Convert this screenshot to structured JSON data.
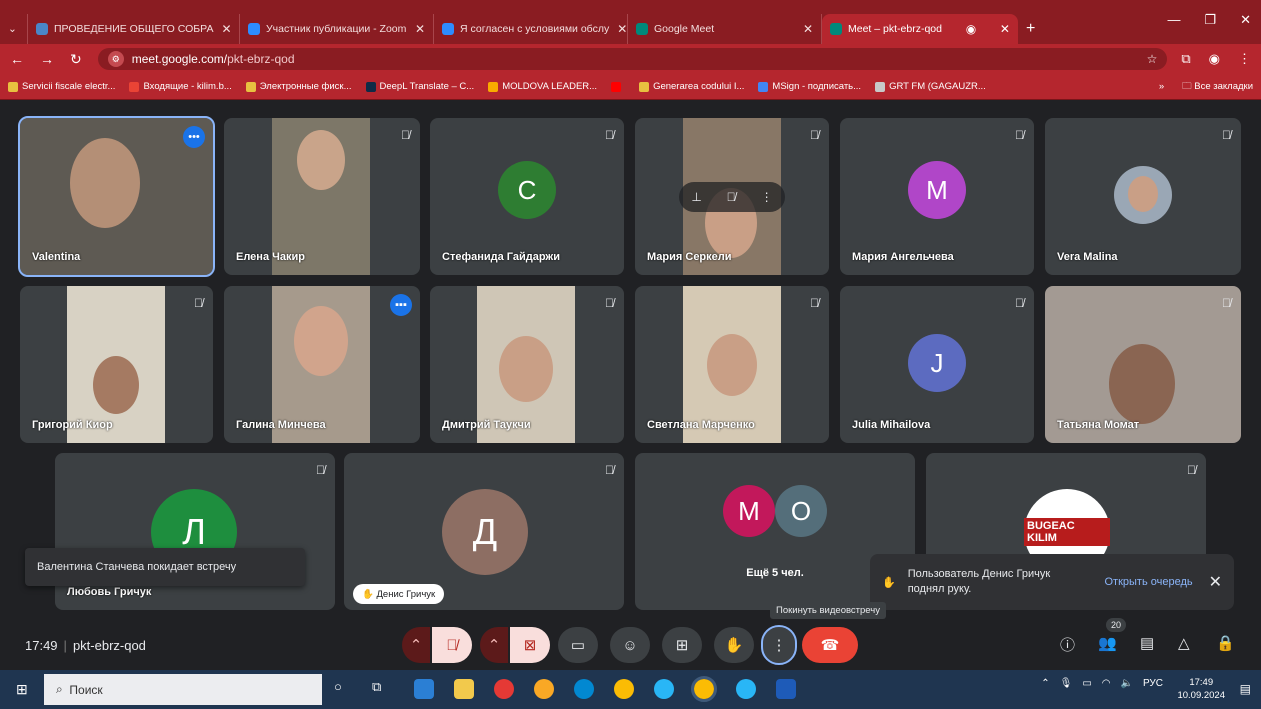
{
  "browser": {
    "tabs": [
      {
        "title": "ПРОВЕДЕНИЕ ОБЩЕГО СОБРА",
        "color": "#4a86c8"
      },
      {
        "title": "Участник публикации - Zoom",
        "color": "#2d8cff"
      },
      {
        "title": "Я согласен с условиями обслу",
        "color": "#2d8cff"
      },
      {
        "title": "Google Meet",
        "color": "#00897b"
      },
      {
        "title": "Meet – pkt-ebrz-qod",
        "color": "#00897b",
        "active": true
      }
    ],
    "url_host": "meet.google.com/",
    "url_path": "pkt-ebrz-qod",
    "bookmarks": [
      "Servicii fiscale electr...",
      "Входящие - kilim.b...",
      "Электронные фиск...",
      "DeepL Translate – C...",
      "MOLDOVA LEADER...",
      "Generarea codului I...",
      "MSign - подписать...",
      "GRT FM (GAGAUZR..."
    ],
    "all_bookmarks": "Все закладки"
  },
  "participants": [
    {
      "name": "Valentina",
      "type": "video"
    },
    {
      "name": "Елена Чакир",
      "type": "video"
    },
    {
      "name": "Стефанида Гайдаржи",
      "type": "avatar",
      "initial": "С",
      "color": "#2e7d32"
    },
    {
      "name": "Мария Серкели",
      "type": "video"
    },
    {
      "name": "Мария Ангельчева",
      "type": "avatar",
      "initial": "М",
      "color": "#b046c8"
    },
    {
      "name": "Vera Malina",
      "type": "photo"
    },
    {
      "name": "Григорий Киор",
      "type": "video"
    },
    {
      "name": "Галина Минчева",
      "type": "video"
    },
    {
      "name": "Дмитрий Таукчи",
      "type": "video"
    },
    {
      "name": "Светлана Марченко",
      "type": "video"
    },
    {
      "name": "Julia Mihailova",
      "type": "avatar",
      "initial": "J",
      "color": "#5c6bc0"
    },
    {
      "name": "Татьяна Момат",
      "type": "video"
    },
    {
      "name": "Любовь Гричук",
      "type": "avatar",
      "initial": "Л",
      "color": "#1e8e3e"
    },
    {
      "name": "",
      "type": "avatar",
      "initial": "Д",
      "color": "#8d6e63"
    },
    {
      "name": "",
      "type": "more",
      "initials": [
        "М",
        "О"
      ],
      "more_text": "Ещё 5 чел."
    },
    {
      "name": "",
      "type": "logo",
      "logo_text": "BUGEAC KILIM"
    }
  ],
  "toast_leaving": "Валентина Станчева покидает встречу",
  "hand_chip": "Денис Гричук",
  "hand_notice": {
    "message_line1": "Пользователь Денис Гричук",
    "message_line2": "поднял руку.",
    "open_queue": "Открыть очередь"
  },
  "tooltip": "Покинуть видеовстречу",
  "meeting": {
    "time": "17:49",
    "code": "pkt-ebrz-qod",
    "people_count": "20"
  },
  "taskbar": {
    "search_placeholder": "Поиск",
    "lang": "РУС",
    "time": "17:49",
    "date": "10.09.2024"
  }
}
